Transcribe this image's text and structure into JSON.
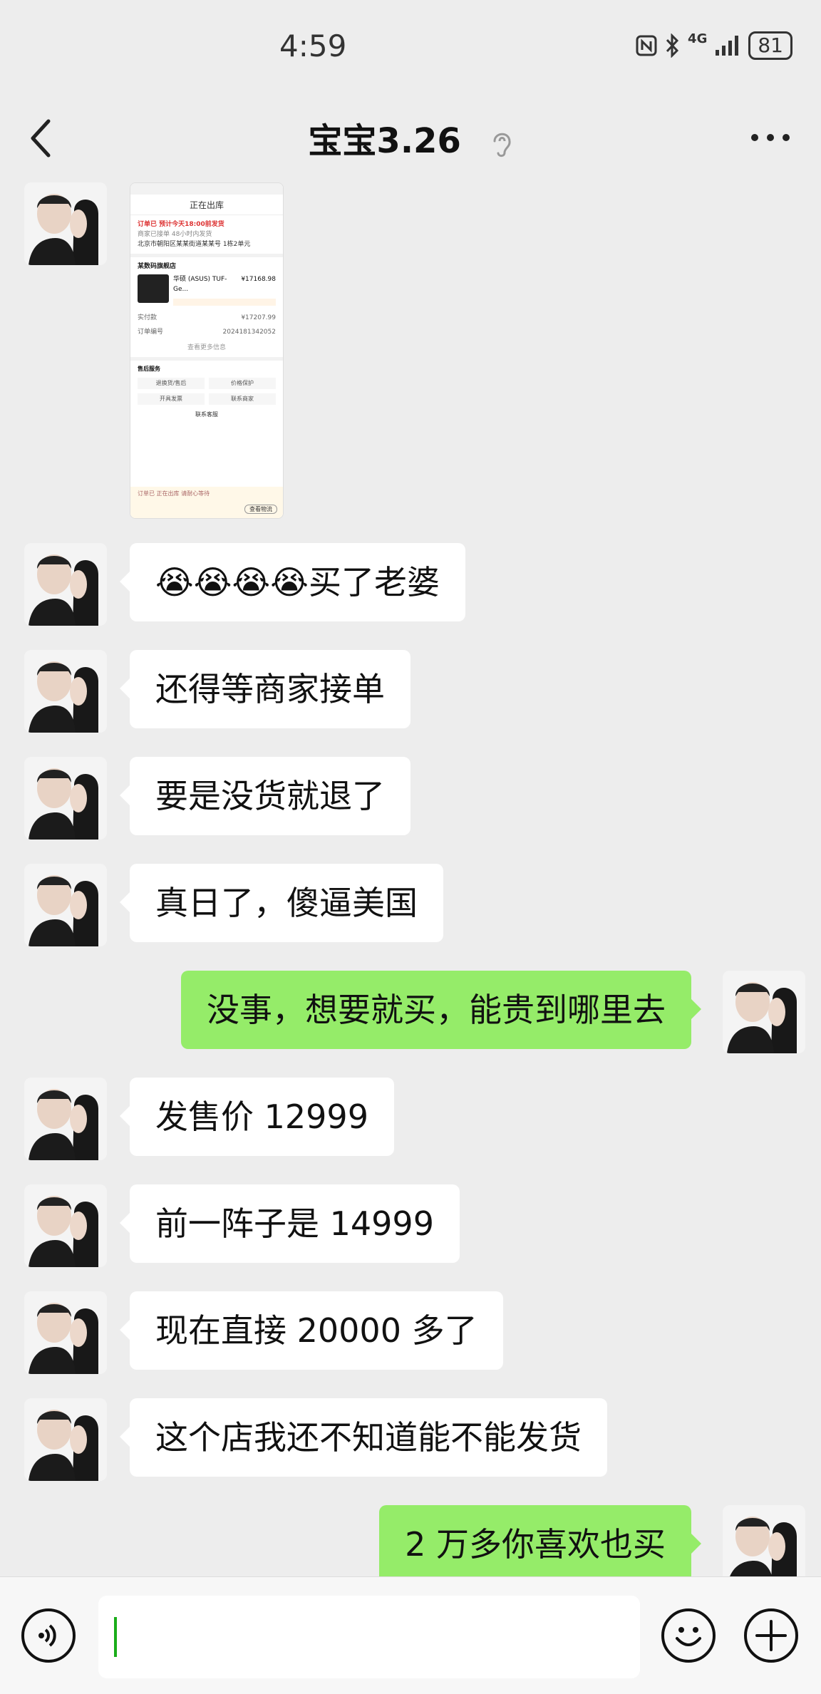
{
  "status_bar": {
    "time": "4:59",
    "network": "4G",
    "battery": "81"
  },
  "header": {
    "title": "宝宝3.26"
  },
  "shared_image": {
    "top_label": "正在出库",
    "red_line": "订单已 预计今天18:00前发货",
    "sub_line": "商家已接单 48小时内发货",
    "address": "北京市朝阳区某某街道某某号 1栋2单元",
    "shop": "某数码旗舰店",
    "product": "华硕 (ASUS) TUF-Ge...",
    "price": "¥17168.98",
    "total_label": "实付款",
    "total": "¥17207.99",
    "order_label": "订单编号",
    "order_no": "2024181342052",
    "more": "查看更多信息",
    "service_label": "售后服务",
    "svc1": "退换货/售后",
    "svc2": "价格保护",
    "svc3": "开具发票",
    "svc4": "联系商家",
    "contact": "联系客服",
    "footer_note": "订单已 正在出库 请耐心等待",
    "footer_btn": "查看物流"
  },
  "messages": [
    {
      "side": "left",
      "text": "😭😭😭😭买了老婆"
    },
    {
      "side": "left",
      "text": "还得等商家接单"
    },
    {
      "side": "left",
      "text": "要是没货就退了"
    },
    {
      "side": "left",
      "text": "真日了，傻逼美国"
    },
    {
      "side": "right",
      "text": "没事，想要就买，能贵到哪里去"
    },
    {
      "side": "left",
      "text": "发售价 12999"
    },
    {
      "side": "left",
      "text": "前一阵子是 14999"
    },
    {
      "side": "left",
      "text": "现在直接 20000 多了"
    },
    {
      "side": "left",
      "text": "这个店我还不知道能不能发货"
    },
    {
      "side": "right",
      "text": "2 万多你喜欢也买"
    }
  ],
  "input": {
    "value": ""
  },
  "colors": {
    "background": "#ededed",
    "right_bubble": "#95ec69",
    "left_bubble": "#ffffff"
  },
  "icons": [
    "back-icon",
    "ear-icon",
    "more-icon",
    "voice-icon",
    "emoji-icon",
    "plus-icon"
  ]
}
